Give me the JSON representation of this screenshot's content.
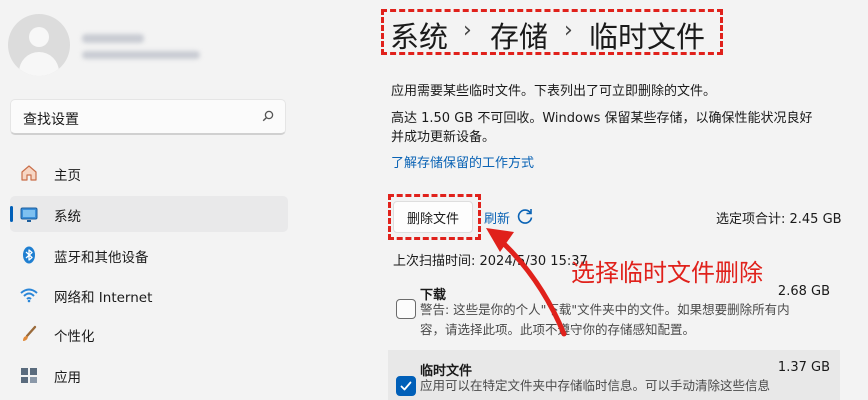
{
  "breadcrumb": [
    "系统",
    "存储",
    "临时文件"
  ],
  "search": {
    "placeholder": "查找设置"
  },
  "nav": [
    {
      "label": "主页",
      "icon": "home-icon"
    },
    {
      "label": "系统",
      "icon": "monitor-icon",
      "selected": true
    },
    {
      "label": "蓝牙和其他设备",
      "icon": "bluetooth-icon"
    },
    {
      "label": "网络和 Internet",
      "icon": "wifi-icon"
    },
    {
      "label": "个性化",
      "icon": "brush-icon"
    },
    {
      "label": "应用",
      "icon": "apps-icon"
    }
  ],
  "main": {
    "desc1": "应用需要某些临时文件。下表列出了可立即删除的文件。",
    "desc2a": "高达 1.50 GB 不可回收。Windows 保留某些存储，以确保性能状况良好",
    "desc2b": "并成功更新设备。",
    "link": "了解存储保留的工作方式",
    "delete_button": "删除文件",
    "refresh_label": "刷新",
    "total_selected": "选定项合计: 2.45 GB",
    "last_scan": "上次扫描时间: 2024/5/30 15:37"
  },
  "categories": [
    {
      "title": "下载",
      "size": "2.68 GB",
      "checked": false,
      "desc1": "警告: 这些是你的个人\"下载\"文件夹中的文件。如果想要删除所有内",
      "desc2": "容，请选择此项。此项不遵守你的存储感知配置。"
    },
    {
      "title": "临时文件",
      "size": "1.37 GB",
      "checked": true,
      "desc1": "应用可以在特定文件夹中存储临时信息。可以手动清除这些信息"
    }
  ],
  "annotation": "选择临时文件删除",
  "colors": {
    "accent": "#005fb8",
    "link": "#0a63b5",
    "annotation_red": "#e0211b"
  }
}
